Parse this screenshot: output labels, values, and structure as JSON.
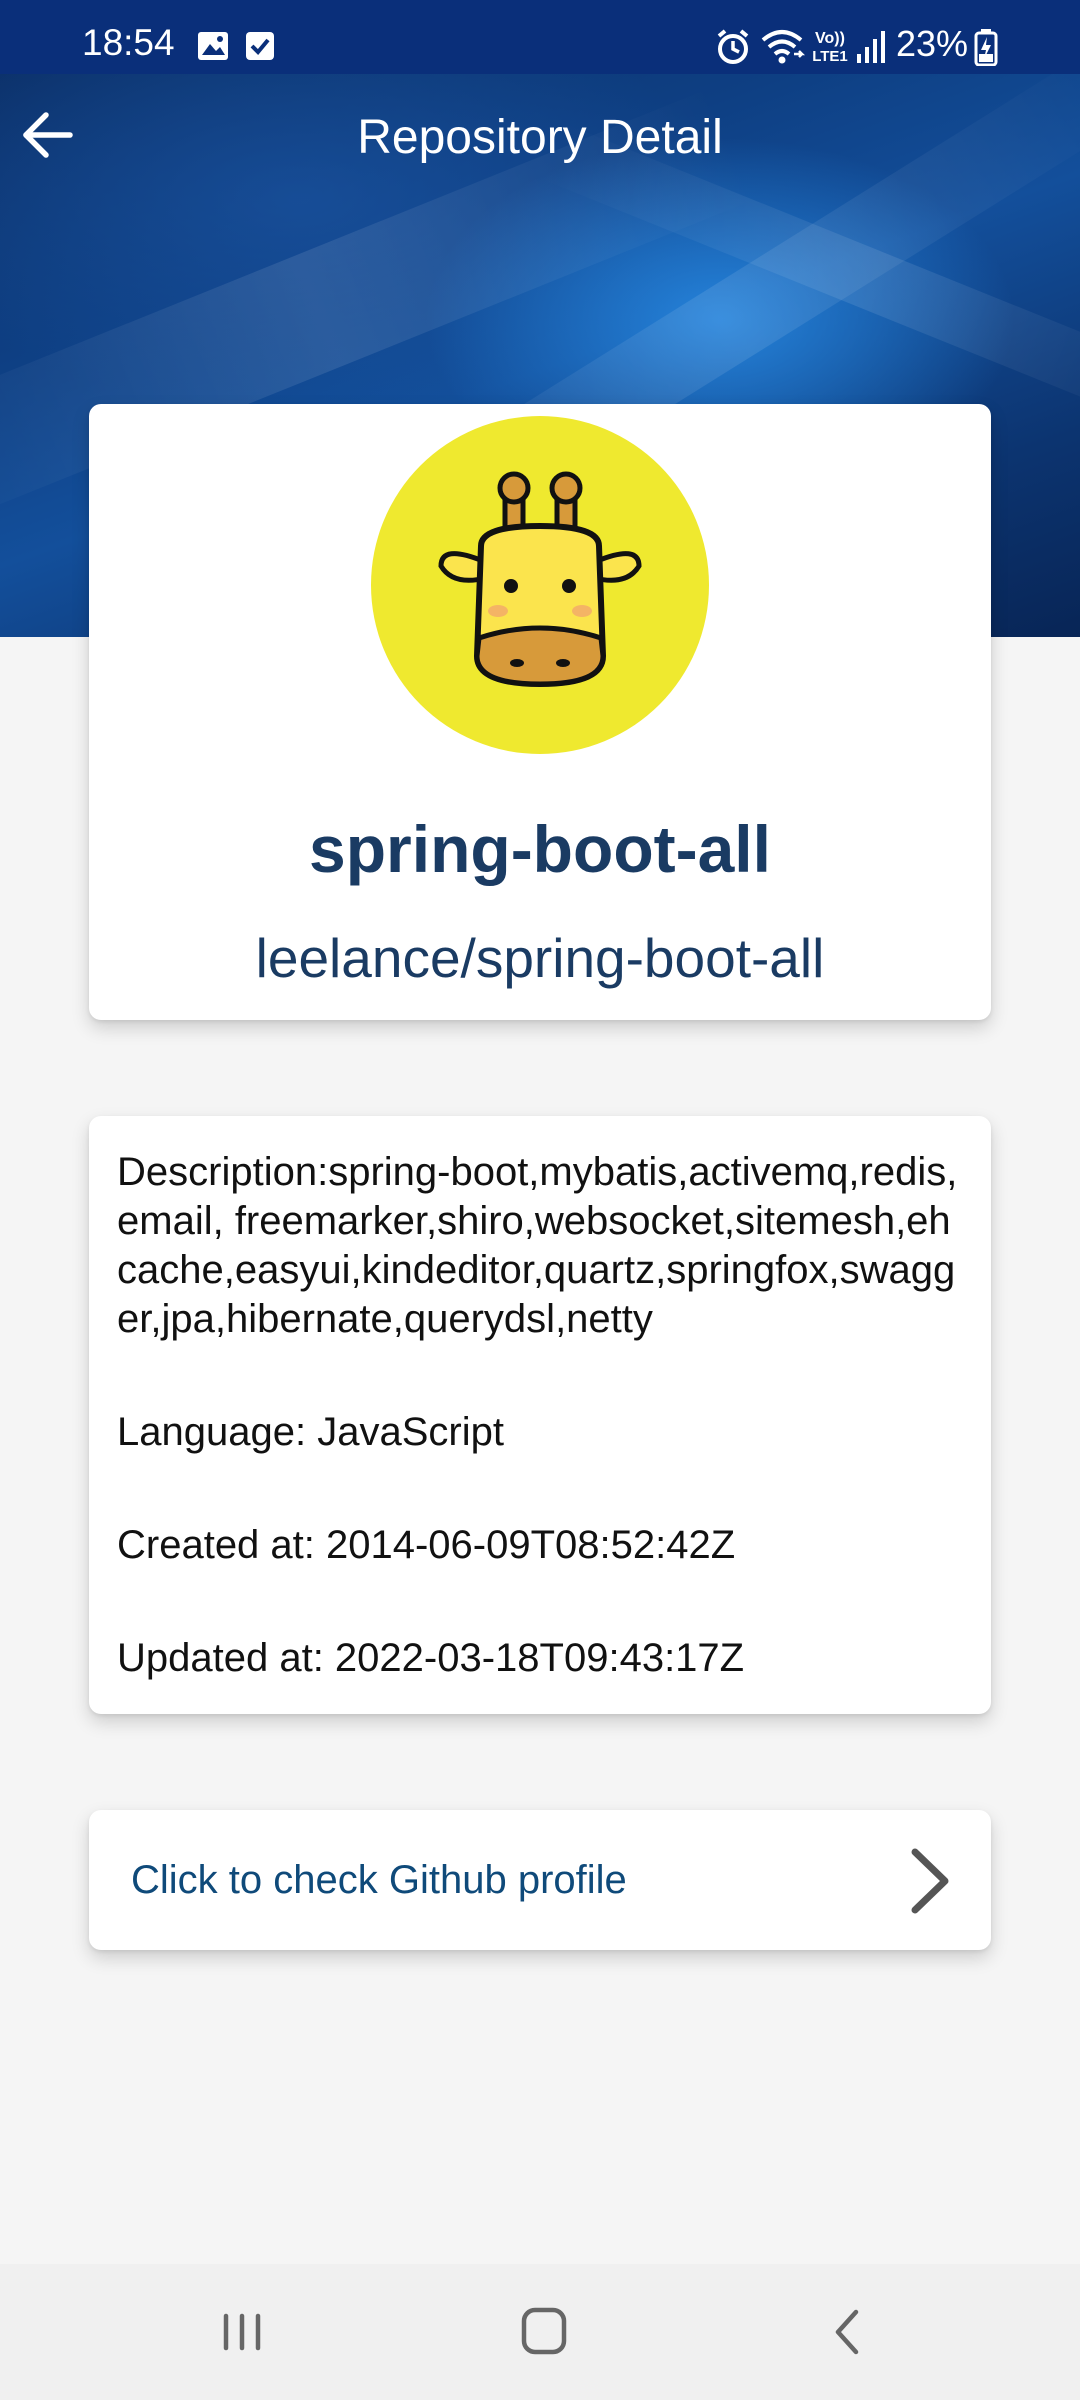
{
  "status_bar": {
    "time": "18:54",
    "left_icons": [
      "image-icon",
      "check-box-icon"
    ],
    "right_icons": [
      "alarm-icon",
      "wifi-calling-icon",
      "volte-icon",
      "signal-icon",
      "battery-charging-icon"
    ],
    "battery": "23%",
    "volte_label": "Vo)) LTE1"
  },
  "app_bar": {
    "title": "Repository Detail",
    "back_icon": "arrow-back-icon"
  },
  "repository": {
    "avatar_icon": "giraffe-avatar-icon",
    "name": "spring-boot-all",
    "full_name": "leelance/spring-boot-all",
    "description": "Description:spring-boot,mybatis,activemq,redis,email, freemarker,shiro,websocket,sitemesh,ehcache,easyui,kindeditor,quartz,springfox,swagger,jpa,hibernate,querydsl,netty",
    "language": "Language: JavaScript",
    "created_at": "Created at: 2014-06-09T08:52:42Z",
    "updated_at": "Updated at: 2022-03-18T09:43:17Z"
  },
  "profile_link": {
    "label": "Click to check Github profile",
    "icon": "chevron-right-icon"
  },
  "nav_bar": {
    "icons": [
      "recent-apps-icon",
      "home-icon",
      "back-icon"
    ]
  },
  "colors": {
    "status_bar": "#0a2f7a",
    "header": "#0e3f83",
    "accent_text": "#1a3b63",
    "link_text": "#0f4a7a",
    "avatar_bg": "#efe92f",
    "page_bg": "#f5f5f5"
  }
}
